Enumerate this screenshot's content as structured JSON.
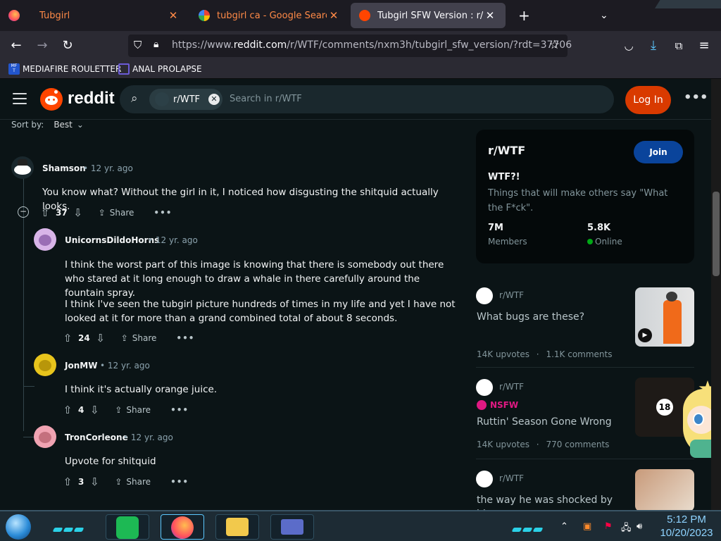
{
  "browser": {
    "tabs": [
      {
        "label": "Tubgirl",
        "active": false
      },
      {
        "label": "tubgirl ca - Google Search",
        "active": false
      },
      {
        "label": "Tubgirl SFW Version : r/WTF",
        "active": true
      }
    ],
    "new_tab_glyph": "+",
    "url_prefix": "https://www.",
    "url_domain": "reddit.com",
    "url_path": "/r/WTF/comments/nxm3h/tubgirl_sfw_version/?rdt=37706",
    "bookmarks": [
      {
        "label": "MEDIAFIRE ROULETTER",
        "icon": "mf-icon"
      },
      {
        "label": "ANAL PROLAPSE",
        "icon": "bookmark-icon"
      }
    ],
    "bookmark_badge": "MF\nT"
  },
  "reddit": {
    "logo_text": "reddit",
    "search_chip": "r/WTF",
    "search_placeholder": "Search in r/WTF",
    "login_label": "Log In",
    "more_label": "•••",
    "sort_label": "Sort by:",
    "sort_value": "Best",
    "comments": [
      {
        "user": "Shamson",
        "time": "• 12 yr. ago",
        "text": "You know what? Without the girl in it, I noticed how disgusting the shitquid actually looks.",
        "votes": "37",
        "share": "Share",
        "dots": "•••"
      },
      {
        "user": "UnicornsDildoHorns",
        "time": "• 12 yr. ago",
        "text": "I think the worst part of this image is knowing that there is somebody out there who stared at it long enough to draw a whale in there carefully around the fountain spray.",
        "text2": "I think I've seen the tubgirl picture hundreds of times in my life and yet I have not looked at it for more than a grand combined total of about 8 seconds.",
        "votes": "24",
        "share": "Share",
        "dots": "•••"
      },
      {
        "user": "JonMW",
        "time": "• 12 yr. ago",
        "text": "I think it's actually orange juice.",
        "votes": "4",
        "share": "Share",
        "dots": "•••"
      },
      {
        "user": "TronCorleone",
        "time": "• 12 yr. ago",
        "text": "Upvote for shitquid",
        "votes": "3",
        "share": "Share",
        "dots": "•••"
      }
    ],
    "collapse_glyph": "−"
  },
  "sidebar": {
    "title": "r/WTF",
    "join_label": "Join",
    "subtitle": "WTF?!",
    "description": "Things that will make others say \"What the F*ck\".",
    "members_value": "7M",
    "members_label": "Members",
    "online_value": "5.8K",
    "online_label": "Online",
    "posts": [
      {
        "sub": "r/WTF",
        "title": "What bugs are these?",
        "upvotes": "14K upvotes",
        "comments": "1.1K comments",
        "nsfw": false,
        "sep": "·"
      },
      {
        "sub": "r/WTF",
        "title": "Ruttin' Season Gone Wrong",
        "upvotes": "14K upvotes",
        "comments": "770 comments",
        "nsfw": true,
        "nsfw_label": "NSFW",
        "badge": "18",
        "sep": "·"
      },
      {
        "sub": "r/WTF",
        "title": "the way he was shocked by his",
        "nsfw": false
      }
    ]
  },
  "taskbar": {
    "time": "5:12 PM",
    "date": "10/20/2023"
  },
  "colors": {
    "reddit_bg": "#0b1416",
    "accent_orange": "#d93a00",
    "join_blue": "#0a449b",
    "nsfw_pink": "#e01982",
    "online_green": "#01a816"
  }
}
